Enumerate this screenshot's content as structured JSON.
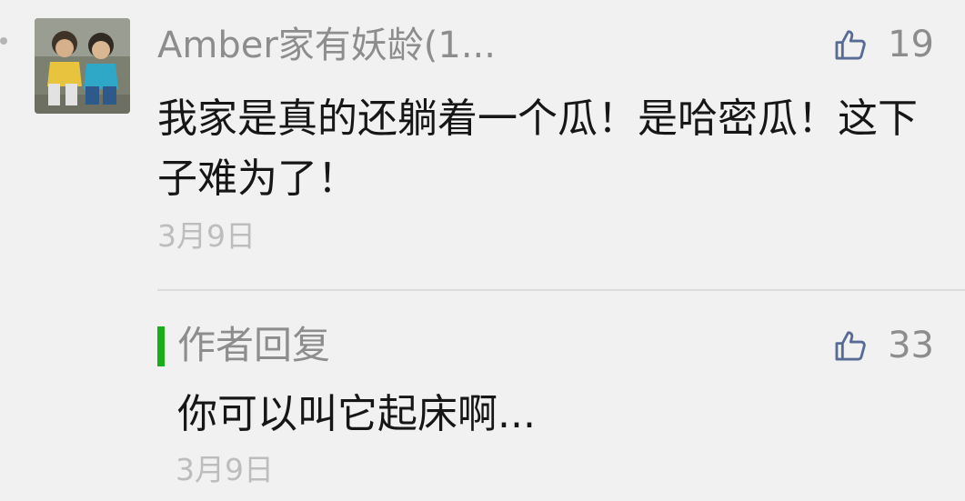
{
  "comment": {
    "author": "Amber家有妖龄(1...",
    "text": "我家是真的还躺着一个瓜！是哈密瓜！这下子难为了！",
    "date": "3月9日",
    "likes": "19"
  },
  "reply": {
    "label": "作者回复",
    "text": "你可以叫它起床啊...",
    "date": "3月9日",
    "likes": "33"
  },
  "icons": {
    "like": "thumbs-up-icon",
    "avatar": "user-avatar"
  },
  "colors": {
    "background": "#f1f1f1",
    "meta_text": "#8d8d8d",
    "date_text": "#bdbdbd",
    "body_text": "#161616",
    "reply_accent": "#1aad19",
    "like_icon": "#576b95"
  }
}
